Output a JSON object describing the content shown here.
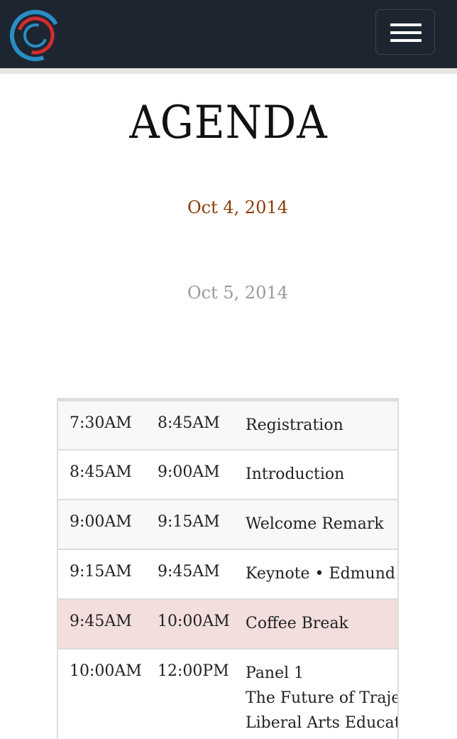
{
  "header": {
    "logo_icon": "circular-swirl-logo",
    "menu_icon": "hamburger-menu-icon",
    "colors": {
      "background": "#1d2630",
      "logo_red": "#d22d2f",
      "logo_blue": "#2a8dc4"
    }
  },
  "page": {
    "title": "AGENDA"
  },
  "dates": [
    {
      "label": "Oct 4, 2014",
      "active": true,
      "color": "#8a3a05"
    },
    {
      "label": "Oct 5, 2014",
      "active": false,
      "color": "#999999"
    }
  ],
  "agenda": [
    {
      "start": "7:30AM",
      "end": "8:45AM",
      "title": [
        "Registration"
      ]
    },
    {
      "start": "8:45AM",
      "end": "9:00AM",
      "title": [
        "Introduction"
      ]
    },
    {
      "start": "9:00AM",
      "end": "9:15AM",
      "title": [
        "Welcome Remark"
      ]
    },
    {
      "start": "9:15AM",
      "end": "9:45AM",
      "title": [
        "Keynote • Edmund"
      ]
    },
    {
      "start": "9:45AM",
      "end": "10:00AM",
      "title": [
        "Coffee Break"
      ],
      "highlight": true
    },
    {
      "start": "10:00AM",
      "end": "12:00PM",
      "title": [
        "Panel 1",
        "The Future of Traje",
        "Liberal Arts Educat"
      ]
    }
  ]
}
